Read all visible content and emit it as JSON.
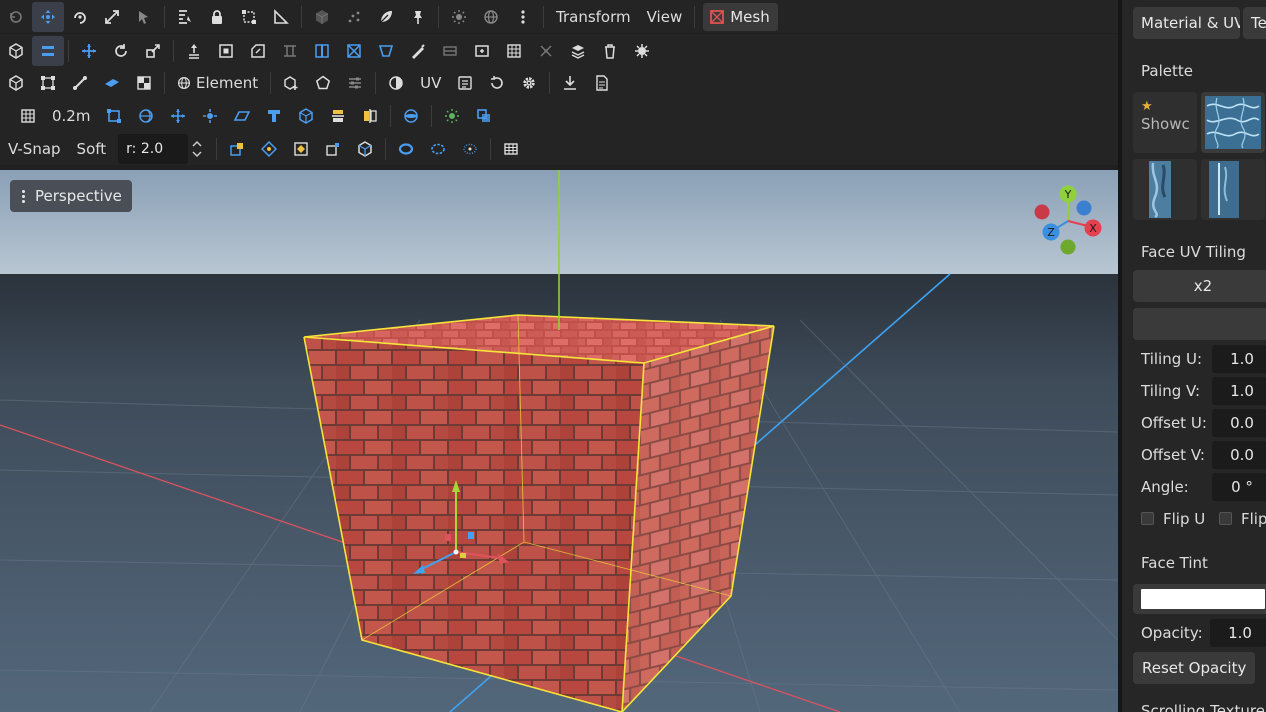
{
  "toolbar1": {
    "transform_label": "Transform",
    "view_label": "View",
    "mesh_label": "Mesh"
  },
  "toolbar3": {
    "element_label": "Element",
    "uv_label": "UV"
  },
  "toolbar4": {
    "grid_size": "0.2m"
  },
  "toolbar5": {
    "vsnap_label": "V-Snap",
    "soft_label": "Soft",
    "radius_value": "r: 2.0"
  },
  "viewport": {
    "perspective_label": "Perspective",
    "gizmo": {
      "y": "Y",
      "x": "X",
      "z": "Z"
    }
  },
  "panel": {
    "tabs": [
      "Material & UV",
      "Te"
    ],
    "palette_title": "Palette",
    "palette_items": [
      {
        "label": "Showc",
        "star": "★"
      }
    ],
    "face_uv_tiling_title": "Face UV Tiling",
    "x2_label": "x2",
    "fields": [
      {
        "label": "Tiling U:",
        "value": "1.0"
      },
      {
        "label": "Tiling V:",
        "value": "1.0"
      },
      {
        "label": "Offset U:",
        "value": "0.0"
      },
      {
        "label": "Offset V:",
        "value": "0.0"
      },
      {
        "label": "Angle:",
        "value": "0 °"
      }
    ],
    "flip_u_label": "Flip U",
    "flip_v_label": "Flip",
    "face_tint_title": "Face Tint",
    "tint_color": "#ffffff",
    "opacity_label": "Opacity:",
    "opacity_value": "1.0",
    "reset_opacity_label": "Reset Opacity",
    "next_section_partial": "Scrolling Texture"
  },
  "colors": {
    "accent_blue": "#4a9df0",
    "selection_yellow": "#f5e43a",
    "brick": "#b8483f",
    "mesh_icon_red": "#e05252"
  }
}
